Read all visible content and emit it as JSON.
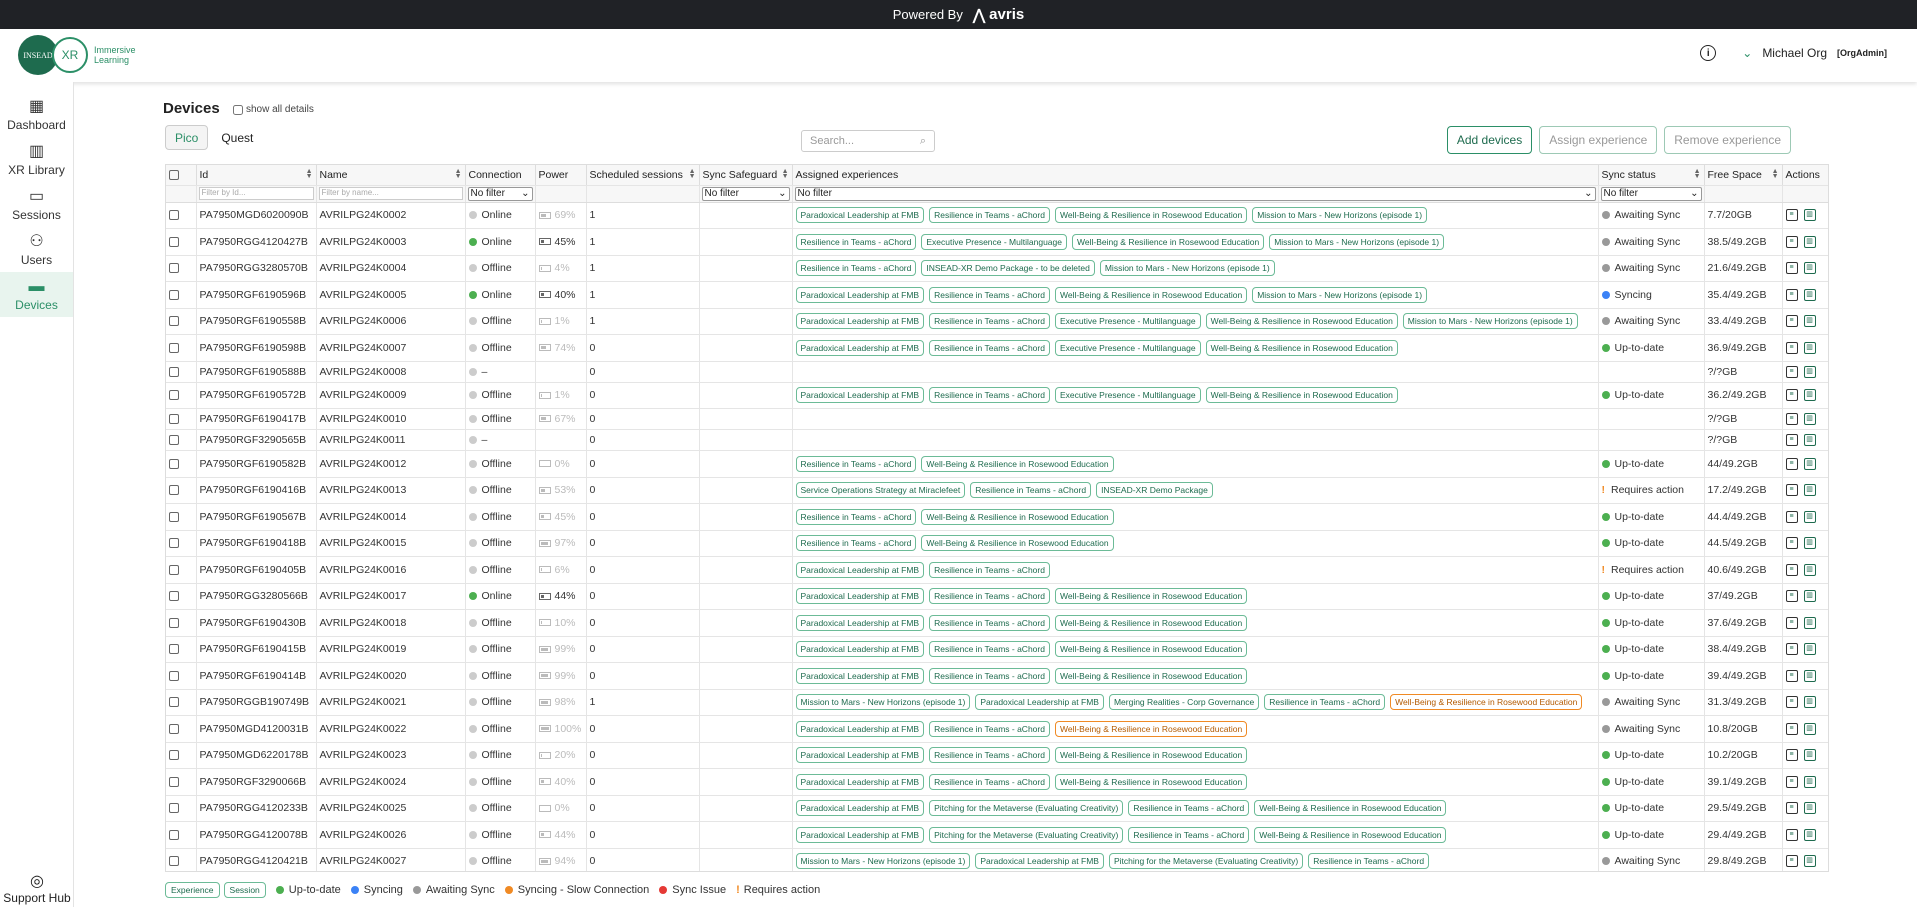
{
  "topbar": {
    "powered_by": "Powered By",
    "brand": "avris"
  },
  "logo": {
    "insead": "INSEAD",
    "xr": "XR",
    "text": "Immersive Learning"
  },
  "user": {
    "info_icon": "info-icon",
    "name": "Michael Org",
    "role": "[OrgAdmin]"
  },
  "sidebar": {
    "items": [
      {
        "label": "Dashboard",
        "icon": "grid-icon"
      },
      {
        "label": "XR Library",
        "icon": "library-icon"
      },
      {
        "label": "Sessions",
        "icon": "sessions-icon"
      },
      {
        "label": "Users",
        "icon": "users-icon"
      },
      {
        "label": "Devices",
        "icon": "headset-icon"
      }
    ],
    "support": "Support Hub"
  },
  "page": {
    "title": "Devices",
    "show_all": "show all details"
  },
  "tabs": [
    "Pico",
    "Quest"
  ],
  "search": {
    "placeholder": "Search..."
  },
  "buttons": {
    "add": "Add devices",
    "assign": "Assign experience",
    "remove": "Remove experience"
  },
  "columns": [
    "Id",
    "Name",
    "Connection",
    "Power",
    "Scheduled sessions",
    "Sync Safeguard",
    "Assigned experiences",
    "Sync status",
    "Free Space",
    "Actions"
  ],
  "filters": {
    "id": "Filter by Id...",
    "name": "Filter by name...",
    "none": "No filter"
  },
  "rows": [
    {
      "id": "PA7950MGD6020090B",
      "name": "AVRILPG24K0002",
      "conn": "Online",
      "online": false,
      "power": "69%",
      "pct": 69,
      "dim": true,
      "sched": "1",
      "exps": [
        "Paradoxical Leadership at FMB",
        "Resilience in Teams - aChord",
        "Well-Being & Resilience in Rosewood Education",
        "Mission to Mars - New Horizons (episode 1)"
      ],
      "orange": [],
      "status": "Awaiting Sync",
      "scolor": "#999",
      "space": "7.7/20GB"
    },
    {
      "id": "PA7950RGG4120427B",
      "name": "AVRILPG24K0003",
      "conn": "Online",
      "online": true,
      "power": "45%",
      "pct": 45,
      "dim": false,
      "sched": "1",
      "exps": [
        "Resilience in Teams - aChord",
        "Executive Presence - Multilanguage",
        "Well-Being & Resilience in Rosewood Education",
        "Mission to Mars - New Horizons (episode 1)"
      ],
      "orange": [],
      "status": "Awaiting Sync",
      "scolor": "#999",
      "space": "38.5/49.2GB"
    },
    {
      "id": "PA7950RGG3280570B",
      "name": "AVRILPG24K0004",
      "conn": "Offline",
      "online": false,
      "power": "4%",
      "pct": 4,
      "dim": true,
      "sched": "1",
      "exps": [
        "Resilience in Teams - aChord",
        "INSEAD-XR Demo Package - to be deleted",
        "Mission to Mars - New Horizons (episode 1)"
      ],
      "orange": [],
      "status": "Awaiting Sync",
      "scolor": "#999",
      "space": "21.6/49.2GB"
    },
    {
      "id": "PA7950RGF6190596B",
      "name": "AVRILPG24K0005",
      "conn": "Online",
      "online": true,
      "power": "40%",
      "pct": 40,
      "dim": false,
      "sched": "1",
      "exps": [
        "Paradoxical Leadership at FMB",
        "Resilience in Teams - aChord",
        "Well-Being & Resilience in Rosewood Education",
        "Mission to Mars - New Horizons (episode 1)"
      ],
      "orange": [],
      "status": "Syncing",
      "scolor": "#3b82f6",
      "space": "35.4/49.2GB"
    },
    {
      "id": "PA7950RGF6190558B",
      "name": "AVRILPG24K0006",
      "conn": "Offline",
      "online": false,
      "power": "1%",
      "pct": 1,
      "dim": true,
      "sched": "1",
      "exps": [
        "Paradoxical Leadership at FMB",
        "Resilience in Teams - aChord",
        "Executive Presence - Multilanguage",
        "Well-Being & Resilience in Rosewood Education",
        "Mission to Mars - New Horizons (episode 1)"
      ],
      "orange": [],
      "status": "Awaiting Sync",
      "scolor": "#999",
      "space": "33.4/49.2GB"
    },
    {
      "id": "PA7950RGF6190598B",
      "name": "AVRILPG24K0007",
      "conn": "Offline",
      "online": false,
      "power": "74%",
      "pct": 74,
      "dim": true,
      "sched": "0",
      "exps": [
        "Paradoxical Leadership at FMB",
        "Resilience in Teams - aChord",
        "Executive Presence - Multilanguage",
        "Well-Being & Resilience in Rosewood Education"
      ],
      "orange": [],
      "status": "Up-to-date",
      "scolor": "#4caf50",
      "space": "36.9/49.2GB"
    },
    {
      "id": "PA7950RGF6190588B",
      "name": "AVRILPG24K0008",
      "conn": "–",
      "online": false,
      "power": "",
      "pct": 0,
      "dim": true,
      "sched": "0",
      "exps": [],
      "orange": [],
      "status": "",
      "scolor": "",
      "space": "?/?GB",
      "short": true
    },
    {
      "id": "PA7950RGF6190572B",
      "name": "AVRILPG24K0009",
      "conn": "Offline",
      "online": false,
      "power": "1%",
      "pct": 1,
      "dim": true,
      "sched": "0",
      "exps": [
        "Paradoxical Leadership at FMB",
        "Resilience in Teams - aChord",
        "Executive Presence - Multilanguage",
        "Well-Being & Resilience in Rosewood Education"
      ],
      "orange": [],
      "status": "Up-to-date",
      "scolor": "#4caf50",
      "space": "36.2/49.2GB"
    },
    {
      "id": "PA7950RGF6190417B",
      "name": "AVRILPG24K0010",
      "conn": "Offline",
      "online": false,
      "power": "67%",
      "pct": 67,
      "dim": true,
      "sched": "0",
      "exps": [],
      "orange": [],
      "status": "",
      "scolor": "",
      "space": "?/?GB",
      "short": true
    },
    {
      "id": "PA7950RGF3290565B",
      "name": "AVRILPG24K0011",
      "conn": "–",
      "online": false,
      "power": "",
      "pct": 0,
      "dim": true,
      "sched": "0",
      "exps": [],
      "orange": [],
      "status": "",
      "scolor": "",
      "space": "?/?GB",
      "short": true
    },
    {
      "id": "PA7950RGF6190582B",
      "name": "AVRILPG24K0012",
      "conn": "Offline",
      "online": false,
      "power": "0%",
      "pct": 0,
      "dim": true,
      "sched": "0",
      "exps": [
        "Resilience in Teams - aChord",
        "Well-Being & Resilience in Rosewood Education"
      ],
      "orange": [],
      "status": "Up-to-date",
      "scolor": "#4caf50",
      "space": "44/49.2GB"
    },
    {
      "id": "PA7950RGF6190416B",
      "name": "AVRILPG24K0013",
      "conn": "Offline",
      "online": false,
      "power": "53%",
      "pct": 53,
      "dim": true,
      "sched": "0",
      "exps": [
        "Service Operations Strategy at Miraclefeet",
        "Resilience in Teams - aChord",
        "INSEAD-XR Demo Package"
      ],
      "orange": [],
      "status": "Requires action",
      "scolor": "req",
      "space": "17.2/49.2GB"
    },
    {
      "id": "PA7950RGF6190567B",
      "name": "AVRILPG24K0014",
      "conn": "Offline",
      "online": false,
      "power": "45%",
      "pct": 45,
      "dim": true,
      "sched": "0",
      "exps": [
        "Resilience in Teams - aChord",
        "Well-Being & Resilience in Rosewood Education"
      ],
      "orange": [],
      "status": "Up-to-date",
      "scolor": "#4caf50",
      "space": "44.4/49.2GB"
    },
    {
      "id": "PA7950RGF6190418B",
      "name": "AVRILPG24K0015",
      "conn": "Offline",
      "online": false,
      "power": "97%",
      "pct": 97,
      "dim": true,
      "sched": "0",
      "exps": [
        "Resilience in Teams - aChord",
        "Well-Being & Resilience in Rosewood Education"
      ],
      "orange": [],
      "status": "Up-to-date",
      "scolor": "#4caf50",
      "space": "44.5/49.2GB"
    },
    {
      "id": "PA7950RGF6190405B",
      "name": "AVRILPG24K0016",
      "conn": "Offline",
      "online": false,
      "power": "6%",
      "pct": 6,
      "dim": true,
      "sched": "0",
      "exps": [
        "Paradoxical Leadership at FMB",
        "Resilience in Teams - aChord"
      ],
      "orange": [],
      "status": "Requires action",
      "scolor": "req",
      "space": "40.6/49.2GB"
    },
    {
      "id": "PA7950RGG3280566B",
      "name": "AVRILPG24K0017",
      "conn": "Online",
      "online": true,
      "power": "44%",
      "pct": 44,
      "dim": false,
      "sched": "0",
      "exps": [
        "Paradoxical Leadership at FMB",
        "Resilience in Teams - aChord",
        "Well-Being & Resilience in Rosewood Education"
      ],
      "orange": [],
      "status": "Up-to-date",
      "scolor": "#4caf50",
      "space": "37/49.2GB"
    },
    {
      "id": "PA7950RGF6190430B",
      "name": "AVRILPG24K0018",
      "conn": "Offline",
      "online": false,
      "power": "10%",
      "pct": 10,
      "dim": true,
      "sched": "0",
      "exps": [
        "Paradoxical Leadership at FMB",
        "Resilience in Teams - aChord",
        "Well-Being & Resilience in Rosewood Education"
      ],
      "orange": [],
      "status": "Up-to-date",
      "scolor": "#4caf50",
      "space": "37.6/49.2GB"
    },
    {
      "id": "PA7950RGF6190415B",
      "name": "AVRILPG24K0019",
      "conn": "Offline",
      "online": false,
      "power": "99%",
      "pct": 99,
      "dim": true,
      "sched": "0",
      "exps": [
        "Paradoxical Leadership at FMB",
        "Resilience in Teams - aChord",
        "Well-Being & Resilience in Rosewood Education"
      ],
      "orange": [],
      "status": "Up-to-date",
      "scolor": "#4caf50",
      "space": "38.4/49.2GB"
    },
    {
      "id": "PA7950RGF6190414B",
      "name": "AVRILPG24K0020",
      "conn": "Offline",
      "online": false,
      "power": "99%",
      "pct": 99,
      "dim": true,
      "sched": "0",
      "exps": [
        "Paradoxical Leadership at FMB",
        "Resilience in Teams - aChord",
        "Well-Being & Resilience in Rosewood Education"
      ],
      "orange": [],
      "status": "Up-to-date",
      "scolor": "#4caf50",
      "space": "39.4/49.2GB"
    },
    {
      "id": "PA7950RGGB190749B",
      "name": "AVRILPG24K0021",
      "conn": "Offline",
      "online": false,
      "power": "98%",
      "pct": 98,
      "dim": true,
      "sched": "1",
      "exps": [
        "Mission to Mars - New Horizons (episode 1)",
        "Paradoxical Leadership at FMB",
        "Merging Realities - Corp Governance",
        "Resilience in Teams - aChord",
        "Well-Being & Resilience in Rosewood Education"
      ],
      "orange": [
        4
      ],
      "status": "Awaiting Sync",
      "scolor": "#999",
      "space": "31.3/49.2GB"
    },
    {
      "id": "PA7950MGD4120031B",
      "name": "AVRILPG24K0022",
      "conn": "Offline",
      "online": false,
      "power": "100%",
      "pct": 100,
      "dim": true,
      "sched": "0",
      "exps": [
        "Paradoxical Leadership at FMB",
        "Resilience in Teams - aChord",
        "Well-Being & Resilience in Rosewood Education"
      ],
      "orange": [
        2
      ],
      "status": "Awaiting Sync",
      "scolor": "#999",
      "space": "10.8/20GB"
    },
    {
      "id": "PA7950MGD6220178B",
      "name": "AVRILPG24K0023",
      "conn": "Offline",
      "online": false,
      "power": "20%",
      "pct": 20,
      "dim": true,
      "sched": "0",
      "exps": [
        "Paradoxical Leadership at FMB",
        "Resilience in Teams - aChord",
        "Well-Being & Resilience in Rosewood Education"
      ],
      "orange": [],
      "status": "Up-to-date",
      "scolor": "#4caf50",
      "space": "10.2/20GB"
    },
    {
      "id": "PA7950RGF3290066B",
      "name": "AVRILPG24K0024",
      "conn": "Offline",
      "online": false,
      "power": "40%",
      "pct": 40,
      "dim": true,
      "sched": "0",
      "exps": [
        "Paradoxical Leadership at FMB",
        "Resilience in Teams - aChord",
        "Well-Being & Resilience in Rosewood Education"
      ],
      "orange": [],
      "status": "Up-to-date",
      "scolor": "#4caf50",
      "space": "39.1/49.2GB"
    },
    {
      "id": "PA7950RGG4120233B",
      "name": "AVRILPG24K0025",
      "conn": "Offline",
      "online": false,
      "power": "0%",
      "pct": 0,
      "dim": true,
      "sched": "0",
      "exps": [
        "Paradoxical Leadership at FMB",
        "Pitching for the Metaverse (Evaluating Creativity)",
        "Resilience in Teams - aChord",
        "Well-Being & Resilience in Rosewood Education"
      ],
      "orange": [],
      "status": "Up-to-date",
      "scolor": "#4caf50",
      "space": "29.5/49.2GB"
    },
    {
      "id": "PA7950RGG4120078B",
      "name": "AVRILPG24K0026",
      "conn": "Offline",
      "online": false,
      "power": "44%",
      "pct": 44,
      "dim": true,
      "sched": "0",
      "exps": [
        "Paradoxical Leadership at FMB",
        "Pitching for the Metaverse (Evaluating Creativity)",
        "Resilience in Teams - aChord",
        "Well-Being & Resilience in Rosewood Education"
      ],
      "orange": [],
      "status": "Up-to-date",
      "scolor": "#4caf50",
      "space": "29.4/49.2GB"
    },
    {
      "id": "PA7950RGG4120421B",
      "name": "AVRILPG24K0027",
      "conn": "Offline",
      "online": false,
      "power": "94%",
      "pct": 94,
      "dim": true,
      "sched": "0",
      "exps": [
        "Mission to Mars - New Horizons (episode 1)",
        "Paradoxical Leadership at FMB",
        "Pitching for the Metaverse (Evaluating Creativity)",
        "Resilience in Teams - aChord"
      ],
      "orange": [],
      "status": "Awaiting Sync",
      "scolor": "#999",
      "space": "29.8/49.2GB"
    }
  ],
  "legend": {
    "tags": [
      "Experience",
      "Session"
    ],
    "items": [
      {
        "label": "Up-to-date",
        "color": "#4caf50"
      },
      {
        "label": "Syncing",
        "color": "#3b82f6"
      },
      {
        "label": "Awaiting Sync",
        "color": "#999999"
      },
      {
        "label": "Syncing - Slow Connection",
        "color": "#f08a24"
      },
      {
        "label": "Sync Issue",
        "color": "#e53935"
      }
    ],
    "requires": "Requires action"
  }
}
